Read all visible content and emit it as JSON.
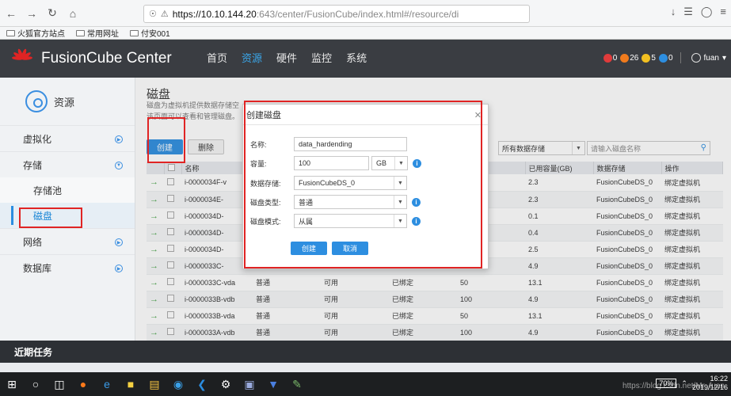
{
  "browser": {
    "url_host": "https://10.10.144.20",
    "url_rest": ":643/center/FusionCube/index.html#/resource/di",
    "bookmarks": [
      "火狐官方站点",
      "常用网址",
      "付安001"
    ]
  },
  "header": {
    "app_title": "FusionCube Center",
    "nav": [
      "首页",
      "资源",
      "硬件",
      "监控",
      "系统"
    ],
    "active_nav": "资源",
    "alarms": [
      {
        "count": "0",
        "color": "#e03b3b"
      },
      {
        "count": "26",
        "color": "#f07b1d"
      },
      {
        "count": "5",
        "color": "#f2c021"
      },
      {
        "count": "0",
        "color": "#2d8ee0"
      }
    ],
    "user": "fuan"
  },
  "sidebar": {
    "title": "资源",
    "items": [
      {
        "label": "虚拟化"
      },
      {
        "label": "存储"
      },
      {
        "label": "存储池"
      },
      {
        "label": "磁盘"
      },
      {
        "label": "网络"
      },
      {
        "label": "数据库"
      }
    ]
  },
  "main": {
    "title": "磁盘",
    "desc_line1": "磁盘为虚拟机提供数据存储空",
    "desc_line2": "该页面可以查看和管理磁盘。",
    "create_label": "创建",
    "delete_label": "删除",
    "storage_filter": "所有数据存储",
    "search_placeholder": "请输入磁盘名称"
  },
  "table": {
    "headers": [
      "名称",
      "",
      "",
      "",
      "B)",
      "已用容量(GB)",
      "数据存储",
      "操作"
    ],
    "rows": [
      [
        "i-0000034F-v",
        "",
        "",
        "",
        "",
        "2.3",
        "FusionCubeDS_0",
        "绑定虚拟机"
      ],
      [
        "i-0000034E-",
        "",
        "",
        "",
        "",
        "2.3",
        "FusionCubeDS_0",
        "绑定虚拟机"
      ],
      [
        "i-0000034D-",
        "",
        "",
        "",
        "",
        "0.1",
        "FusionCubeDS_0",
        "绑定虚拟机"
      ],
      [
        "i-0000034D-",
        "",
        "",
        "",
        "",
        "0.4",
        "FusionCubeDS_0",
        "绑定虚拟机"
      ],
      [
        "i-0000034D-",
        "",
        "",
        "",
        "",
        "2.5",
        "FusionCubeDS_0",
        "绑定虚拟机"
      ],
      [
        "i-0000033C-",
        "",
        "",
        "",
        "",
        "4.9",
        "FusionCubeDS_0",
        "绑定虚拟机"
      ],
      [
        "i-0000033C-vda",
        "普通",
        "可用",
        "已绑定",
        "50",
        "13.1",
        "FusionCubeDS_0",
        "绑定虚拟机"
      ],
      [
        "i-0000033B-vdb",
        "普通",
        "可用",
        "已绑定",
        "100",
        "4.9",
        "FusionCubeDS_0",
        "绑定虚拟机"
      ],
      [
        "i-0000033B-vda",
        "普通",
        "可用",
        "已绑定",
        "50",
        "13.1",
        "FusionCubeDS_0",
        "绑定虚拟机"
      ],
      [
        "i-0000033A-vdb",
        "普通",
        "可用",
        "已绑定",
        "100",
        "4.9",
        "FusionCubeDS_0",
        "绑定虚拟机"
      ]
    ]
  },
  "dialog": {
    "title": "创建磁盘",
    "name_label": "名称:",
    "name_value": "data_hardending",
    "capacity_label": "容量:",
    "capacity_value": "100",
    "capacity_unit": "GB",
    "datastore_label": "数据存储:",
    "datastore_value": "FusionCubeDS_0",
    "disk_type_label": "磁盘类型:",
    "disk_type_value": "普通",
    "disk_mode_label": "磁盘模式:",
    "disk_mode_value": "从属",
    "create_label": "创建",
    "cancel_label": "取消"
  },
  "footer": {
    "recent_tasks": "近期任务"
  },
  "taskbar": {
    "battery": "70%",
    "time": "16:22",
    "date": "2019/12/16",
    "watermark": "https://blog.csdn.net/Mr_fuan"
  }
}
